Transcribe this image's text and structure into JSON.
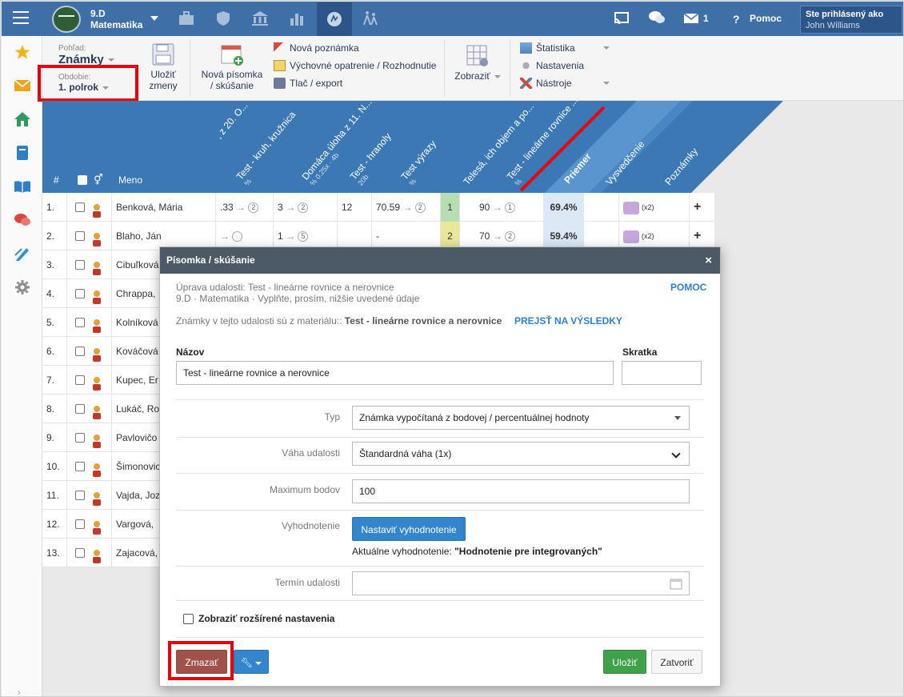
{
  "topbar": {
    "class_name": "9.D",
    "subject": "Matematika",
    "message_count": "1",
    "help_label": "Pomoc",
    "user_label": "Ste prihlásený ako",
    "user_name": "John Williams"
  },
  "toolbar": {
    "view_label": "Pohľad:",
    "view_value": "Známky",
    "period_label": "Obdobie:",
    "period_value": "1. polrok",
    "save_line1": "Uložiť",
    "save_line2": "zmeny",
    "new_test_line1": "Nová písomka",
    "new_test_line2": "/ skúšanie",
    "new_note": "Nová poznámka",
    "edu_measure": "Výchovné opatrenie / Rozhodnutie",
    "print": "Tlač / export",
    "display": "Zobraziť",
    "statistics": "Štatistika",
    "settings": "Nastavenia",
    "tools": "Nástroje"
  },
  "grid": {
    "num_header": "#",
    "name_header": "Meno",
    "columns": [
      {
        "title": ", z 20. O...",
        "sub": ""
      },
      {
        "title": "Test - kruh, kružnica",
        "sub": "%"
      },
      {
        "title": "Domáca úloha z 11. N...",
        "sub": "% 0.25x · 4b"
      },
      {
        "title": "Test - hranoly",
        "sub": "20b"
      },
      {
        "title": "Test výrazy",
        "sub": "%"
      },
      {
        "title": "Telesá, ich objem a po...",
        "sub": ""
      },
      {
        "title": "Test - lineárne rovnice ...",
        "sub": "%"
      },
      {
        "title": "Priemer",
        "sub": ""
      },
      {
        "title": "Vysvedčenie",
        "sub": ""
      },
      {
        "title": "Poznámky",
        "sub": ""
      }
    ],
    "rows": [
      {
        "n": "1.",
        "name": "Benková, Mária",
        "c1": ".33",
        "c1b": "2",
        "c2": "3",
        "c2b": "2",
        "c3": "12",
        "c4": "70.59",
        "c4b": "2",
        "c5": "1",
        "c6": "90",
        "c6b": "1",
        "avg": "69.4%",
        "note": "(x2)"
      },
      {
        "n": "2.",
        "name": "Blaho, Ján",
        "c1": "",
        "c1b": "",
        "c2": "1",
        "c2b": "5",
        "c3": "",
        "c4": "-",
        "c4b": "",
        "c5": "2",
        "c6": "70",
        "c6b": "2",
        "avg": "59.4%",
        "note": "(x2)"
      },
      {
        "n": "3.",
        "name": "Cibuľková"
      },
      {
        "n": "4.",
        "name": "Chrappa,"
      },
      {
        "n": "5.",
        "name": "Kolníková"
      },
      {
        "n": "6.",
        "name": "Kováčová"
      },
      {
        "n": "7.",
        "name": "Kupec, Er"
      },
      {
        "n": "8.",
        "name": "Lukáč, Ro"
      },
      {
        "n": "9.",
        "name": "Pavlovičo"
      },
      {
        "n": "10.",
        "name": "Šimonovic"
      },
      {
        "n": "11.",
        "name": "Vajda, Joz"
      },
      {
        "n": "12.",
        "name": "Vargová,"
      },
      {
        "n": "13.",
        "name": "Zajacová,"
      }
    ]
  },
  "modal": {
    "title": "Písomka / skúšanie",
    "close": "×",
    "edit_line": "Úprava udalosti: Test - lineárne rovnice a nerovnice",
    "sub_line": "9.D · Matematika · Vyplňte, prosím, nižšie uvedené údaje",
    "help": "POMOC",
    "material_prefix": "Známky v tejto udalosti sú z materiálu::",
    "material_name": "Test - lineárne rovnice a nerovnice",
    "go_results": "PREJSŤ NA VÝSLEDKY",
    "name_label": "Názov",
    "name_value": "Test - lineárne rovnice a nerovnice",
    "abbr_label": "Skratka",
    "abbr_value": "",
    "type_label": "Typ",
    "type_value": "Známka vypočítaná z bodovej / percentuálnej hodnoty",
    "weight_label": "Váha udalosti",
    "weight_value": "Štandardná váha (1x)",
    "max_label": "Maximum bodov",
    "max_value": "100",
    "eval_label": "Vyhodnotenie",
    "eval_button": "Nastaviť vyhodnotenie",
    "eval_current_prefix": "Aktuálne vyhodnotenie:",
    "eval_current_value": "\"Hodnotenie pre integrovaných\"",
    "date_label": "Termín udalosti",
    "date_value": "",
    "advanced": "Zobraziť rozšírené nastavenia",
    "delete": "Zmazať",
    "save": "Uložiť",
    "close_btn": "Zatvoriť"
  },
  "colors": {
    "topbar": "#3e6fa6",
    "header_blue": "#3c78b4",
    "delete": "#a0524a",
    "save": "#3fa14a",
    "eval_btn": "#3385cc",
    "highlight": "#e8000a"
  }
}
